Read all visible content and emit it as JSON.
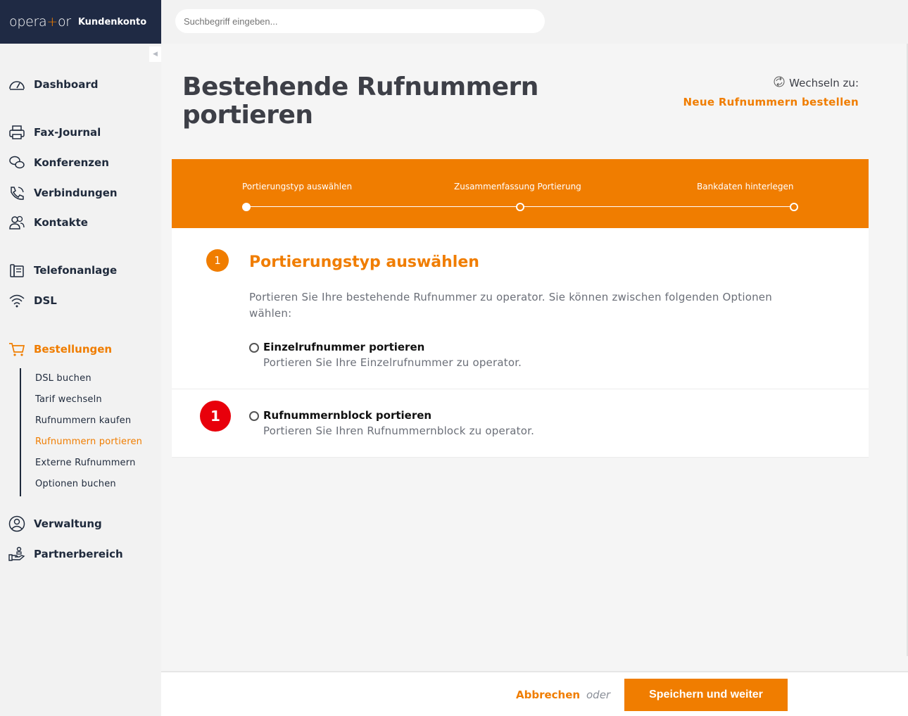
{
  "brand": {
    "logo_pre": "opera",
    "logo_plus": "+",
    "logo_post": "or",
    "sub": "Kundenkonto"
  },
  "search": {
    "placeholder": "Suchbegriff eingeben..."
  },
  "sidebar": {
    "items": [
      {
        "label": "Dashboard",
        "icon": "speedometer-icon"
      },
      {
        "label": "Fax-Journal",
        "icon": "printer-icon"
      },
      {
        "label": "Konferenzen",
        "icon": "chat-bubbles-icon"
      },
      {
        "label": "Verbindungen",
        "icon": "phone-icon"
      },
      {
        "label": "Kontakte",
        "icon": "contacts-icon"
      },
      {
        "label": "Telefonanlage",
        "icon": "phone-system-icon"
      },
      {
        "label": "DSL",
        "icon": "wifi-icon"
      },
      {
        "label": "Bestellungen",
        "icon": "cart-icon"
      },
      {
        "label": "Verwaltung",
        "icon": "user-circle-icon"
      },
      {
        "label": "Partnerbereich",
        "icon": "partner-hand-icon"
      }
    ],
    "sub_items": [
      "DSL buchen",
      "Tarif wechseln",
      "Rufnummern kaufen",
      "Rufnummern portieren",
      "Externe Rufnummern",
      "Optionen buchen"
    ]
  },
  "page": {
    "title_line1": "Bestehende Rufnummern",
    "title_line2": "portieren",
    "switch_label": "Wechseln zu:",
    "switch_link": "Neue Rufnummern bestellen"
  },
  "steps": [
    "Portierungstyp auswählen",
    "Zusammenfassung Portierung",
    "Bankdaten hinterlegen"
  ],
  "section": {
    "number": "1",
    "title": "Portierungstyp auswählen",
    "intro": "Portieren Sie Ihre bestehende Rufnummer zu operator. Sie können zwischen folgenden Optionen wählen:",
    "options": [
      {
        "title": "Einzelrufnummer portieren",
        "desc": "Portieren Sie Ihre Einzelrufnummer zu operator."
      },
      {
        "title": "Rufnummernblock portieren",
        "desc": "Portieren Sie Ihren Rufnummernblock zu operator."
      }
    ],
    "marker": "1"
  },
  "footer": {
    "cancel": "Abbrechen",
    "or": "oder",
    "save": "Speichern und weiter"
  },
  "colors": {
    "accent": "#f07d00",
    "brand_dark": "#1f2a44",
    "marker_red": "#e8000b"
  }
}
